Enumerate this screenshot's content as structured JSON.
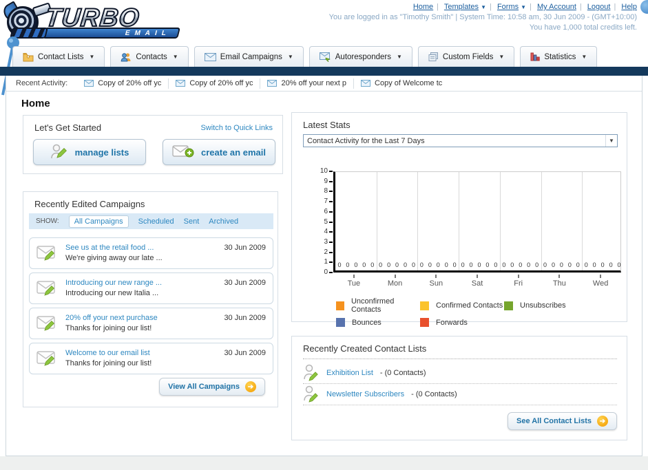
{
  "header": {
    "nav": [
      {
        "label": "Home"
      },
      {
        "label": "Templates"
      },
      {
        "label": "Forms"
      },
      {
        "label": "My Account"
      },
      {
        "label": "Logout"
      },
      {
        "label": "Help"
      }
    ],
    "login_line": "You are logged in as \"Timothy Smith\" | System Time: 10:58 am, 30 Jun 2009 - (GMT+10:00)",
    "credits_line": "You have 1,000 total credits left.",
    "logo_line1": "TURBO",
    "logo_line2": "EMAIL"
  },
  "tabs": [
    {
      "label": "Contact Lists"
    },
    {
      "label": "Contacts"
    },
    {
      "label": "Email Campaigns"
    },
    {
      "label": "Autoresponders"
    },
    {
      "label": "Custom Fields"
    },
    {
      "label": "Statistics"
    }
  ],
  "recent_activity": {
    "label": "Recent Activity:",
    "items": [
      {
        "text": "Copy of 20% off yc"
      },
      {
        "text": "Copy of 20% off yc"
      },
      {
        "text": "20% off your next p"
      },
      {
        "text": "Copy of Welcome tc"
      }
    ]
  },
  "page_title": "Home",
  "get_started": {
    "title": "Let's Get Started",
    "switch_link": "Switch to Quick Links",
    "manage_lists_label": "manage lists",
    "create_email_label": "create an email"
  },
  "campaigns": {
    "title": "Recently Edited Campaigns",
    "show_label": "SHOW:",
    "filters": [
      {
        "label": "All Campaigns"
      },
      {
        "label": "Scheduled"
      },
      {
        "label": "Sent"
      },
      {
        "label": "Archived"
      }
    ],
    "active_filter": "All Campaigns",
    "items": [
      {
        "title": "See us at the retail food ...",
        "subtitle": "We're giving away our late ...",
        "date": "30 Jun 2009"
      },
      {
        "title": "Introducing our new range ...",
        "subtitle": "Introducing our new Italia ...",
        "date": "30 Jun 2009"
      },
      {
        "title": "20% off your next purchase",
        "subtitle": "Thanks for joining our list!",
        "date": "30 Jun 2009"
      },
      {
        "title": "Welcome to our email list",
        "subtitle": "Thanks for joining our list!",
        "date": "30 Jun 2009"
      }
    ],
    "view_all_label": "View All Campaigns"
  },
  "stats": {
    "title": "Latest Stats",
    "dropdown_value": "Contact Activity for the Last 7 Days"
  },
  "chart_data": {
    "type": "bar",
    "title": "Contact Activity for the Last 7 Days",
    "categories": [
      "Tue",
      "Mon",
      "Sun",
      "Sat",
      "Fri",
      "Thu",
      "Wed"
    ],
    "series": [
      {
        "name": "Unconfirmed Contacts",
        "color": "#f5921f",
        "values": [
          0,
          0,
          0,
          0,
          0,
          0,
          0
        ]
      },
      {
        "name": "Confirmed Contacts",
        "color": "#fbc32c",
        "values": [
          0,
          0,
          0,
          0,
          0,
          0,
          0
        ]
      },
      {
        "name": "Unsubscribes",
        "color": "#76a52d",
        "values": [
          0,
          0,
          0,
          0,
          0,
          0,
          0
        ]
      },
      {
        "name": "Bounces",
        "color": "#5873ae",
        "values": [
          0,
          0,
          0,
          0,
          0,
          0,
          0
        ]
      },
      {
        "name": "Forwards",
        "color": "#e8502d",
        "values": [
          0,
          0,
          0,
          0,
          0,
          0,
          0
        ]
      }
    ],
    "ylim": [
      0,
      10
    ],
    "yticks": [
      0,
      1,
      2,
      3,
      4,
      5,
      6,
      7,
      8,
      9,
      10
    ],
    "grid": true,
    "legend_position": "bottom",
    "bar_value_label": "0"
  },
  "contact_lists": {
    "title": "Recently Created Contact Lists",
    "items": [
      {
        "name": "Exhibition List",
        "suffix": " - (0 Contacts)"
      },
      {
        "name": "Newsletter Subscribers",
        "suffix": " - (0 Contacts)"
      }
    ],
    "see_all_label": "See All Contact Lists"
  },
  "colors": {
    "navy_bar": "#14395c",
    "link_blue": "#2d87c0",
    "header_link_blue": "#1b5e9e",
    "button_text_blue": "#1f74a8",
    "orange_accent": "#f29b00"
  }
}
